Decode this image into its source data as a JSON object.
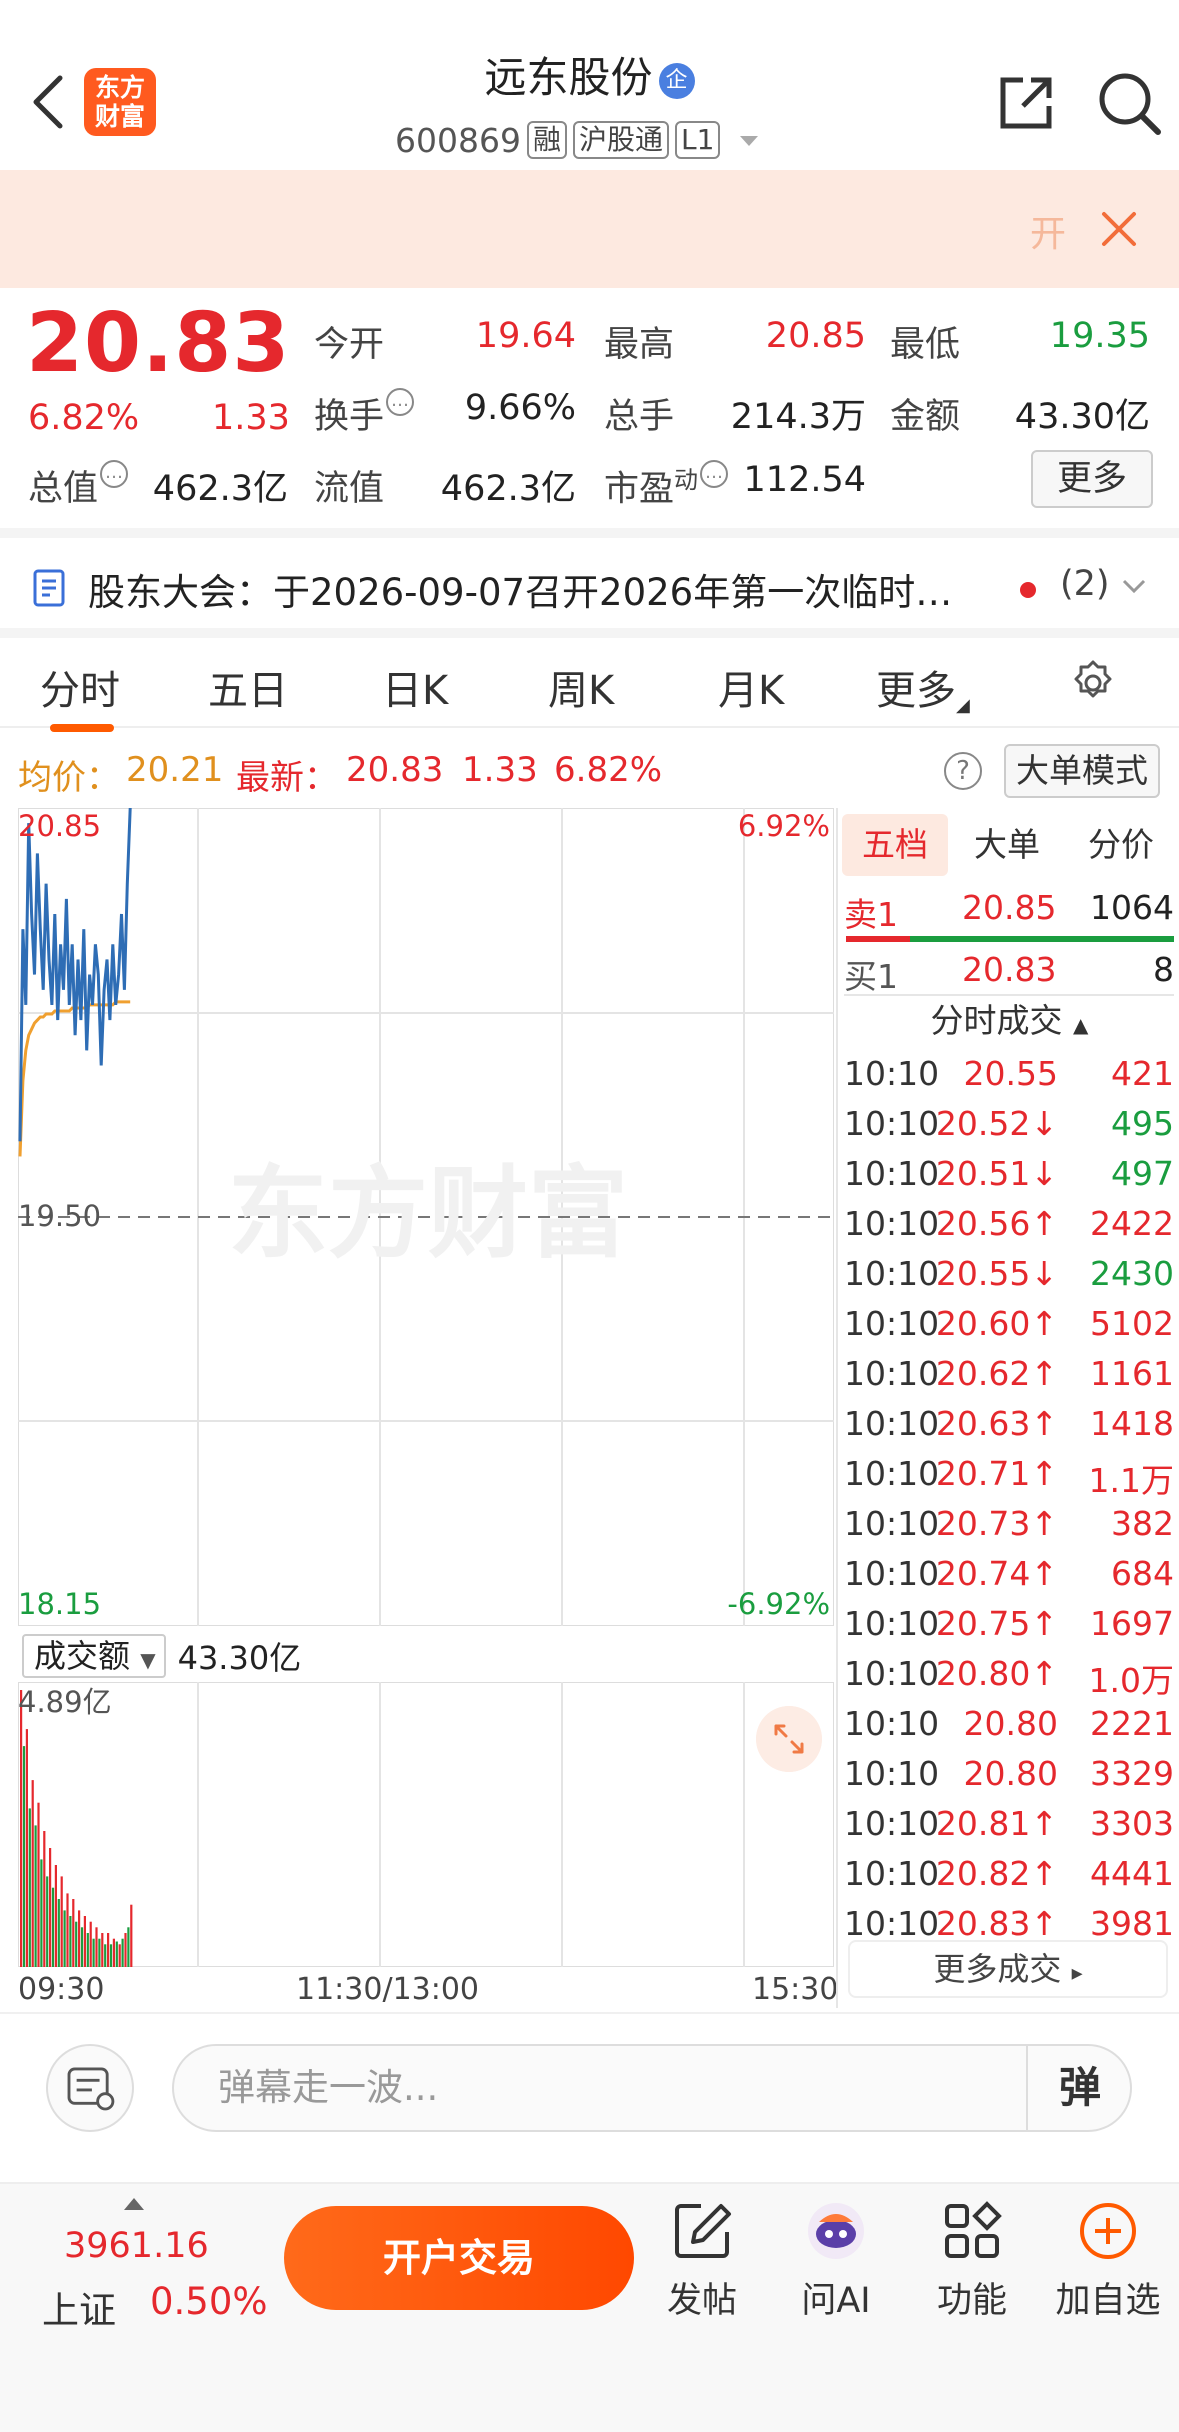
{
  "header": {
    "logo_line1": "东方",
    "logo_line2": "财富",
    "stock_name": "远东股份",
    "badge": "企",
    "stock_code": "600869",
    "tags": [
      "融",
      "沪股通",
      "L1"
    ]
  },
  "banner": {
    "text": "开"
  },
  "quote": {
    "price": "20.83",
    "change_pct": "6.82%",
    "change": "1.33",
    "open_label": "今开",
    "open_value": "19.64",
    "high_label": "最高",
    "high_value": "20.85",
    "low_label": "最低",
    "low_value": "19.35",
    "turnover_label": "换手",
    "turnover_value": "9.66%",
    "volume_label": "总手",
    "volume_value": "214.3万",
    "amount_label": "金额",
    "amount_value": "43.30亿",
    "mktcap_label": "总值",
    "mktcap_value": "462.3亿",
    "float_label": "流值",
    "float_value": "462.3亿",
    "pe_label": "市盈",
    "pe_sup": "动",
    "pe_value": "112.54",
    "more_label": "更多"
  },
  "notice": {
    "text": "股东大会：于2026-09-07召开2026年第一次临时…",
    "count": "(2)"
  },
  "tabs": [
    "分时",
    "五日",
    "日K",
    "周K",
    "月K",
    "更多"
  ],
  "chart_head": {
    "avg_label": "均价：",
    "avg_value": "20.21",
    "latest_label": "最新：",
    "latest_value": "20.83",
    "latest_change": "1.33",
    "latest_pct": "6.82%",
    "help": "?",
    "big_order_mode": "大单模式"
  },
  "chart_labels": {
    "price_top": "20.85",
    "price_mid": "19.50",
    "price_bottom": "18.15",
    "pct_top": "6.92%",
    "pct_bottom": "-6.92%",
    "vol_top": "4.89亿",
    "vol_dropdown": "成交额",
    "vol_total": "43.30亿",
    "time_start": "09:30",
    "time_mid": "11:30/13:00",
    "time_end": "15:30",
    "watermark": "东方财富"
  },
  "chart_data": {
    "type": "line",
    "xlabel": "",
    "ylabel": "",
    "ylim": [
      18.15,
      20.85
    ],
    "series": [
      {
        "values": [
          19.75,
          20.45,
          20.2,
          20.8,
          20.5,
          20.3,
          20.7,
          20.45,
          20.25,
          20.6,
          20.35,
          20.2,
          20.5,
          20.15,
          20.4,
          20.25,
          20.55,
          20.2,
          20.4,
          20.1,
          20.35,
          20.15,
          20.45,
          20.05,
          20.3,
          20.2,
          20.4,
          20.3,
          20.0,
          20.25,
          20.35,
          20.15,
          20.4,
          20.2,
          20.3,
          20.5,
          20.25,
          20.6,
          20.85
        ]
      },
      {
        "values": [
          19.7,
          19.95,
          20.05,
          20.1,
          20.12,
          20.14,
          20.15,
          20.16,
          20.16,
          20.17,
          20.17,
          20.17,
          20.18,
          20.18,
          20.18,
          20.18,
          20.18,
          20.18,
          20.19,
          20.19,
          20.19,
          20.19,
          20.19,
          20.19,
          20.2,
          20.2,
          20.2,
          20.2,
          20.2,
          20.2,
          20.2,
          20.2,
          20.2,
          20.21,
          20.21,
          20.21,
          20.21,
          20.21,
          20.21
        ]
      }
    ],
    "volume": {
      "ylim": [
        0,
        4.89
      ],
      "values": [
        4.89,
        3.9,
        4.2,
        2.8,
        3.3,
        2.5,
        2.9,
        1.9,
        2.4,
        1.6,
        2.1,
        1.4,
        1.8,
        1.2,
        1.6,
        1.0,
        1.3,
        0.9,
        1.2,
        0.8,
        1.0,
        0.7,
        0.9,
        0.6,
        0.8,
        0.5,
        0.7,
        0.5,
        0.6,
        0.4,
        0.6,
        0.4,
        0.5,
        0.45,
        0.4,
        0.5,
        0.6,
        0.7,
        1.1
      ]
    }
  },
  "right_panel": {
    "tabs": [
      "五档",
      "大单",
      "分价"
    ],
    "sell1_label": "卖1",
    "sell1_price": "20.85",
    "sell1_vol": "1064",
    "buy1_label": "买1",
    "buy1_price": "20.83",
    "buy1_vol": "8",
    "trades_title": "分时成交",
    "trades": [
      {
        "t": "10:10",
        "p": "20.55",
        "v": "421",
        "pc": "red",
        "vc": "red"
      },
      {
        "t": "10:10",
        "p": "20.52↓",
        "v": "495",
        "pc": "red",
        "vc": "green"
      },
      {
        "t": "10:10",
        "p": "20.51↓",
        "v": "497",
        "pc": "red",
        "vc": "green"
      },
      {
        "t": "10:10",
        "p": "20.56↑",
        "v": "2422",
        "pc": "red",
        "vc": "red"
      },
      {
        "t": "10:10",
        "p": "20.55↓",
        "v": "2430",
        "pc": "red",
        "vc": "green"
      },
      {
        "t": "10:10",
        "p": "20.60↑",
        "v": "5102",
        "pc": "red",
        "vc": "red"
      },
      {
        "t": "10:10",
        "p": "20.62↑",
        "v": "1161",
        "pc": "red",
        "vc": "red"
      },
      {
        "t": "10:10",
        "p": "20.63↑",
        "v": "1418",
        "pc": "red",
        "vc": "red"
      },
      {
        "t": "10:10",
        "p": "20.71↑",
        "v": "1.1万",
        "pc": "red",
        "vc": "red"
      },
      {
        "t": "10:10",
        "p": "20.73↑",
        "v": "382",
        "pc": "red",
        "vc": "red"
      },
      {
        "t": "10:10",
        "p": "20.74↑",
        "v": "684",
        "pc": "red",
        "vc": "red"
      },
      {
        "t": "10:10",
        "p": "20.75↑",
        "v": "1697",
        "pc": "red",
        "vc": "red"
      },
      {
        "t": "10:10",
        "p": "20.80↑",
        "v": "1.0万",
        "pc": "red",
        "vc": "red"
      },
      {
        "t": "10:10",
        "p": "20.80",
        "v": "2221",
        "pc": "red",
        "vc": "red"
      },
      {
        "t": "10:10",
        "p": "20.80",
        "v": "3329",
        "pc": "red",
        "vc": "red"
      },
      {
        "t": "10:10",
        "p": "20.81↑",
        "v": "3303",
        "pc": "red",
        "vc": "red"
      },
      {
        "t": "10:10",
        "p": "20.82↑",
        "v": "4441",
        "pc": "red",
        "vc": "red"
      },
      {
        "t": "10:10",
        "p": "20.83↑",
        "v": "3981",
        "pc": "red",
        "vc": "red"
      }
    ],
    "more_trades": "更多成交"
  },
  "danmu": {
    "placeholder": "弹幕走一波...",
    "send": "弹"
  },
  "bottom_bar": {
    "index_value": "3961.16",
    "index_name": "上证",
    "index_change": "0.50%",
    "open_trade": "开户交易",
    "post": "发帖",
    "ask_ai": "问AI",
    "functions": "功能",
    "add_watch": "加自选"
  },
  "colors": {
    "up": "#e5282d",
    "down": "#1a9d3f",
    "accent": "#ff5a00",
    "price_line": "#2e6db5",
    "avg_line": "#f0a030"
  }
}
